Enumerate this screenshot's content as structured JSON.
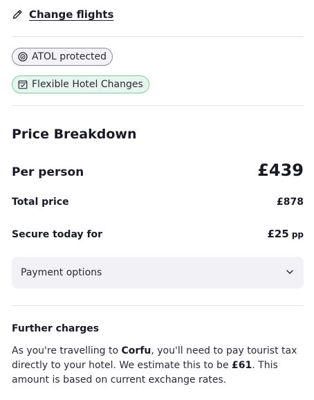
{
  "change_flights": {
    "label": "Change flights",
    "icon": "pencil-icon"
  },
  "badges": [
    {
      "label": "ATOL protected",
      "icon": "atol-icon"
    },
    {
      "label": "Flexible Hotel Changes",
      "icon": "calendar-check-icon"
    }
  ],
  "price_breakdown": {
    "title": "Price Breakdown",
    "per_person_label": "Per person",
    "per_person_value": "£439",
    "total_label": "Total price",
    "total_value": "£878",
    "secure_label": "Secure today for",
    "secure_value": "£25",
    "secure_suffix": "pp"
  },
  "payment_options": {
    "label": "Payment options",
    "icon": "chevron-down-icon"
  },
  "further_charges": {
    "title": "Further charges",
    "text_1": "As you're travelling to ",
    "destination": "Corfu",
    "text_2": ", you'll need to pay tourist tax directly to your hotel. We estimate this to be ",
    "amount": "£61",
    "text_3": ". This amount is based on current exchange rates."
  }
}
